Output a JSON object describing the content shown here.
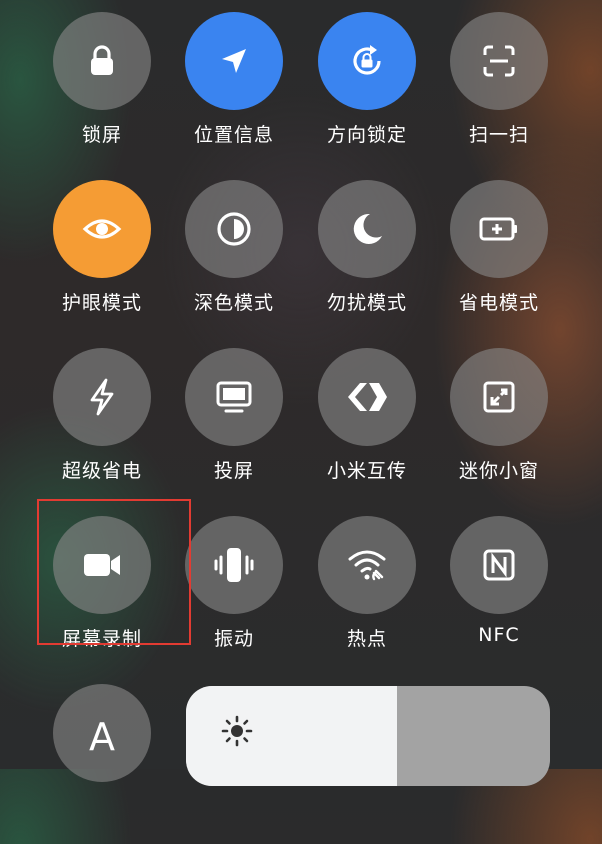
{
  "quick_toggles": [
    {
      "label": "锁屏",
      "icon": "lock-icon",
      "active": false
    },
    {
      "label": "位置信息",
      "icon": "location-arrow-icon",
      "active": true,
      "color": "#3a84f0"
    },
    {
      "label": "方向锁定",
      "icon": "rotation-lock-icon",
      "active": true,
      "color": "#3a84f0"
    },
    {
      "label": "扫一扫",
      "icon": "scan-icon",
      "active": false
    },
    {
      "label": "护眼模式",
      "icon": "eye-icon",
      "active": true,
      "color": "#f59c34"
    },
    {
      "label": "深色模式",
      "icon": "dark-mode-icon",
      "active": false
    },
    {
      "label": "勿扰模式",
      "icon": "moon-icon",
      "active": false
    },
    {
      "label": "省电模式",
      "icon": "battery-icon",
      "active": false
    },
    {
      "label": "超级省电",
      "icon": "lightning-icon",
      "active": false
    },
    {
      "label": "投屏",
      "icon": "monitor-icon",
      "active": false
    },
    {
      "label": "小米互传",
      "icon": "share-transfer-icon",
      "active": false
    },
    {
      "label": "迷你小窗",
      "icon": "mini-window-icon",
      "active": false
    },
    {
      "label": "屏幕录制",
      "icon": "video-camera-icon",
      "active": false,
      "highlighted": true
    },
    {
      "label": "振动",
      "icon": "vibrate-icon",
      "active": false
    },
    {
      "label": "热点",
      "icon": "hotspot-icon",
      "active": false
    },
    {
      "label": "NFC",
      "icon": "nfc-icon",
      "active": false
    }
  ],
  "font_size_toggle": {
    "letter": "A",
    "icon": "font-size-icon"
  },
  "brightness": {
    "icon": "sun-icon",
    "level": 0.58
  },
  "colors": {
    "accent_blue": "#3a84f0",
    "accent_orange": "#f59c34",
    "highlight_red": "#e23b32"
  }
}
